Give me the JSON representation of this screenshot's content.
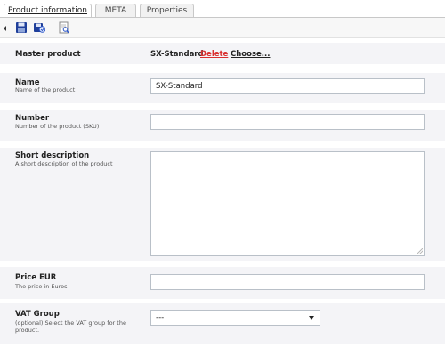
{
  "tabs": [
    {
      "label": "Product information"
    },
    {
      "label": "META"
    },
    {
      "label": "Properties"
    }
  ],
  "toolbar": {
    "icons": [
      "save-icon",
      "save-and-close-icon",
      "preview-icon"
    ]
  },
  "master": {
    "label": "Master product",
    "value": "SX-Standard",
    "delete_label": "Delete",
    "choose_label": "Choose..."
  },
  "name_field": {
    "label": "Name",
    "description": "Name of the product",
    "value": "SX-Standard"
  },
  "number_field": {
    "label": "Number",
    "description": "Number of the product (SKU)",
    "value": ""
  },
  "short_desc_field": {
    "label": "Short description",
    "description": "A short description of the product",
    "value": ""
  },
  "price_field": {
    "label": "Price EUR",
    "description": "The price in Euros",
    "value": ""
  },
  "vat_field": {
    "label": "VAT Group",
    "description_line1": "(optional) Select the VAT group for the",
    "description_line2": "product.",
    "selected": "---"
  }
}
